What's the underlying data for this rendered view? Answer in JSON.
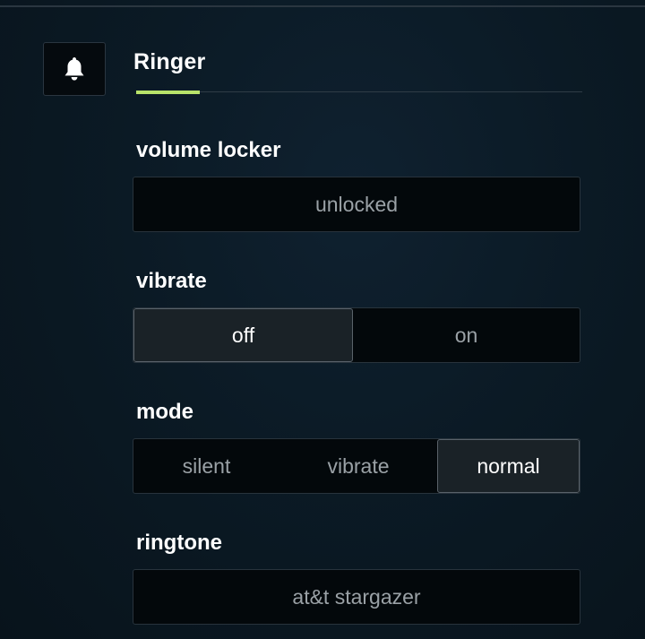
{
  "header": {
    "title": "Ringer",
    "icon": "bell-icon",
    "accent_color": "#b8e36a"
  },
  "volume_locker": {
    "label": "volume locker",
    "value": "unlocked"
  },
  "vibrate": {
    "label": "vibrate",
    "options": [
      "off",
      "on"
    ],
    "selected": "off"
  },
  "mode": {
    "label": "mode",
    "options": [
      "silent",
      "vibrate",
      "normal"
    ],
    "selected": "normal"
  },
  "ringtone": {
    "label": "ringtone",
    "value": "at&t stargazer"
  }
}
